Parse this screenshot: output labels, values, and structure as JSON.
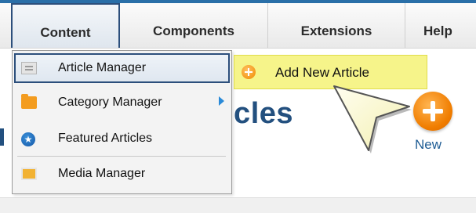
{
  "menubar": {
    "items": [
      {
        "label": "Content",
        "active": true
      },
      {
        "label": "Components",
        "active": false
      },
      {
        "label": "Extensions",
        "active": false
      },
      {
        "label": "Help",
        "active": false
      }
    ]
  },
  "dropdown": {
    "items": [
      {
        "label": "Article Manager",
        "icon": "article-icon",
        "highlighted": true
      },
      {
        "label": "Category Manager",
        "icon": "folder-icon",
        "has_submenu": true
      },
      {
        "label": "Featured Articles",
        "icon": "star-circle-icon"
      },
      {
        "label": "Media Manager",
        "icon": "media-icon"
      }
    ]
  },
  "submenu": {
    "label": "Add New Article",
    "icon": "add-circle-icon",
    "highlight_color": "#f6f48a"
  },
  "page": {
    "heading_visible": "icles"
  },
  "toolbar": {
    "new_label": "New",
    "new_icon": "plus-circle-icon",
    "accent_color": "#f07d00"
  },
  "colors": {
    "brand_blue": "#23507f",
    "top_line": "#2a6fa8",
    "active_border": "#2c4f7c"
  }
}
